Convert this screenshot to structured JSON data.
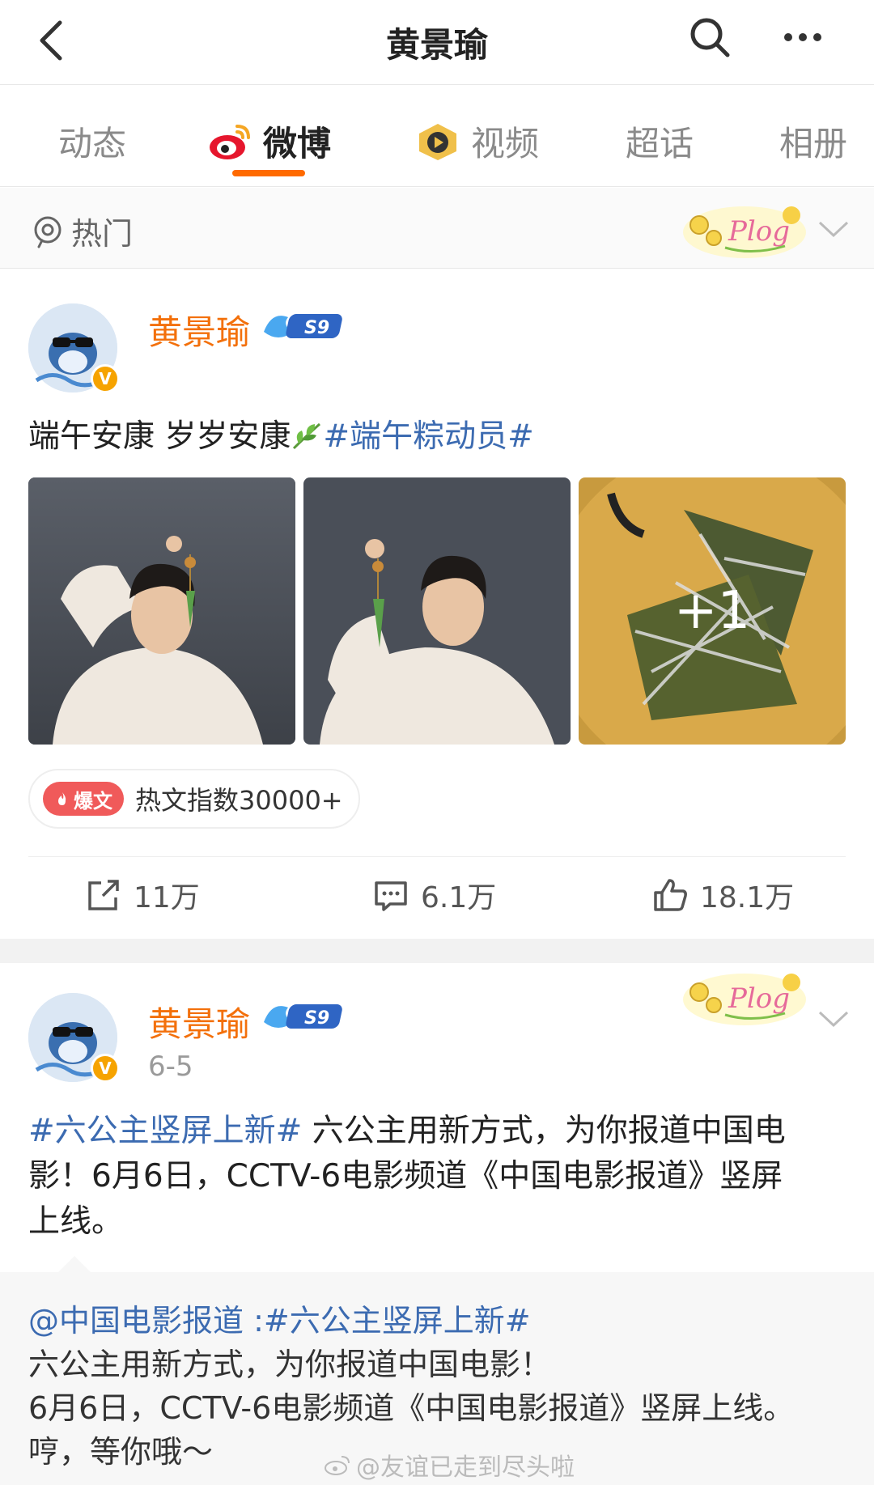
{
  "header": {
    "title": "黄景瑜"
  },
  "tabs": [
    {
      "label": "动态"
    },
    {
      "label": "微博"
    },
    {
      "label": "视频"
    },
    {
      "label": "超话"
    },
    {
      "label": "相册"
    }
  ],
  "filter": {
    "label": "热门"
  },
  "colors": {
    "accent": "#ff6a00",
    "username": "#f3700b",
    "tag": "#3c6bb1",
    "badge_red": "#f05a5a"
  },
  "post1": {
    "username": "黄景瑜",
    "level_badge": "S9",
    "text_plain": "端午安康 岁岁安康",
    "text_tag": "#端午粽动员#",
    "more_count": "+1",
    "hot_badge": "爆文",
    "hot_index": "热文指数30000+",
    "repost": "11万",
    "comment": "6.1万",
    "like": "18.1万"
  },
  "post2": {
    "username": "黄景瑜",
    "level_badge": "S9",
    "date": "6-5",
    "text_tag": "#六公主竖屏上新#",
    "line1_rest": " 六公主用新方式，为你报道中国电",
    "line2": "影！6月6日，CCTV-6电影频道《中国电影报道》竖屏",
    "line3": "上线。",
    "quote": {
      "author": "@中国电影报道",
      "sep": " :",
      "tag": "#六公主竖屏上新#",
      "line1": "六公主用新方式，为你报道中国电影！",
      "line2": "6月6日，CCTV-6电影频道《中国电影报道》竖屏上线。",
      "line3": "哼，等你哦～"
    }
  },
  "watermark": "@友谊已走到尽头啦"
}
